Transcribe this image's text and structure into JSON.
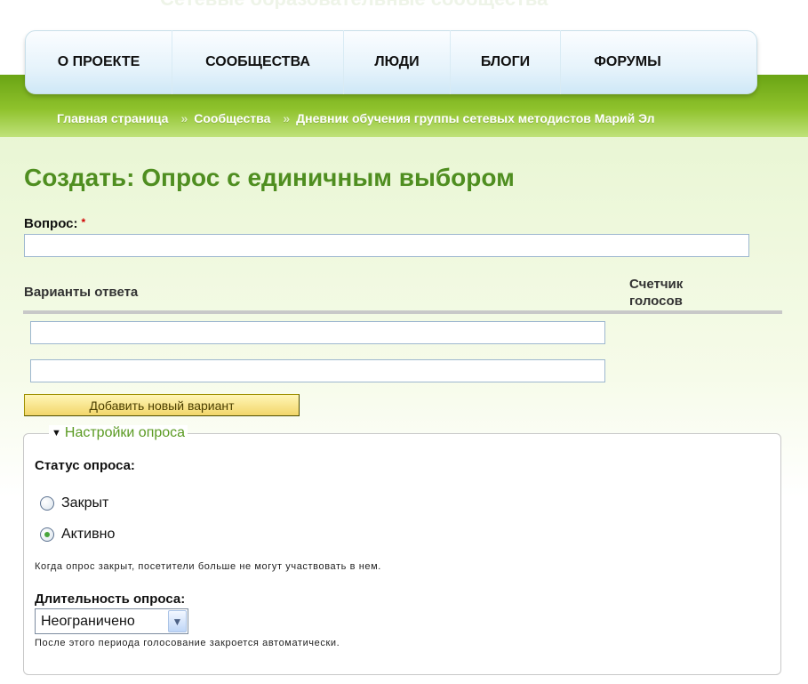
{
  "site_header": {
    "faint_title": "Сетевые образовательные сообщества"
  },
  "nav": {
    "items": [
      {
        "label": "О ПРОЕКТЕ"
      },
      {
        "label": "СООБЩЕСТВА"
      },
      {
        "label": "ЛЮДИ"
      },
      {
        "label": "БЛОГИ"
      },
      {
        "label": "ФОРУМЫ"
      }
    ]
  },
  "breadcrumb": {
    "items": [
      {
        "label": "Главная страница"
      },
      {
        "label": "Сообщества"
      },
      {
        "label": "Дневник обучения группы сетевых методистов Марий Эл"
      }
    ],
    "separator": "»"
  },
  "page": {
    "title": "Создать: Опрос с единичным выбором"
  },
  "form": {
    "question_label": "Вопрос:",
    "required_marker": "*",
    "question_value": "",
    "answers_header": "Варианты ответа",
    "votes_header": "Счетчик голосов",
    "answer_values": [
      "",
      ""
    ],
    "add_option_button": "Добавить новый вариант"
  },
  "poll_settings": {
    "legend": "Настройки опроса",
    "status_label": "Статус опроса:",
    "status_options": [
      {
        "label": "Закрыт",
        "checked": false
      },
      {
        "label": "Активно",
        "checked": true
      }
    ],
    "status_help": "Когда опрос закрыт, посетители больше не могут участвовать в нем.",
    "duration_label": "Длительность опроса:",
    "duration_value": "Неограничено",
    "duration_help": "После этого периода голосование закроется автоматически."
  },
  "colors": {
    "title_green": "#4f8e20",
    "header_green": "#7cb51d",
    "button_yellow": "#f2d66a"
  },
  "icons": {
    "collapse_toggle": "triangle-down-icon",
    "select_arrow": "chevron-down-icon"
  }
}
